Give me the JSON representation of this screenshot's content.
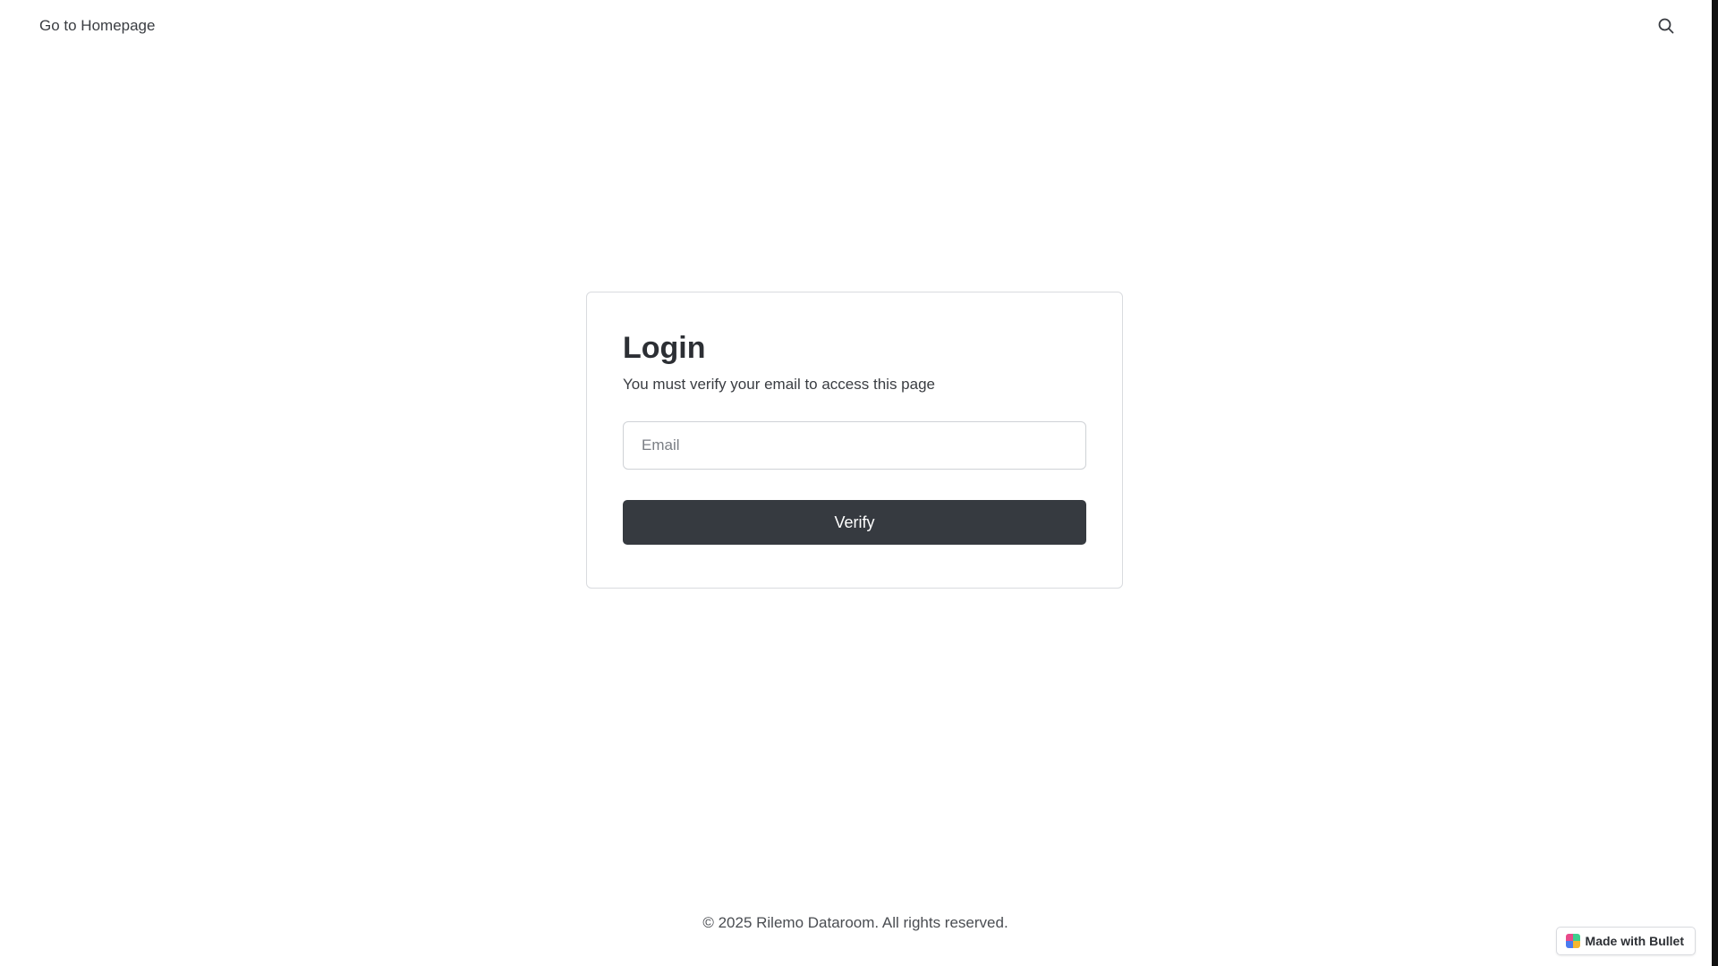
{
  "header": {
    "home_link_label": "Go to Homepage",
    "search_icon": "search-icon"
  },
  "login": {
    "title": "Login",
    "subtitle": "You must verify your email to access this page",
    "email_placeholder": "Email",
    "email_value": "",
    "verify_label": "Verify"
  },
  "footer": {
    "copyright": "© 2025 Rilemo Dataroom. All rights reserved."
  },
  "badge": {
    "label": "Made with Bullet",
    "logo_icon": "bullet-logo-icon"
  },
  "colors": {
    "button_bg": "#363a40",
    "card_border": "#d9dbdf",
    "logo_pink": "#e84a8a",
    "logo_green": "#3ecf8e",
    "logo_blue": "#4a7bf0",
    "logo_yellow": "#f5b731"
  }
}
